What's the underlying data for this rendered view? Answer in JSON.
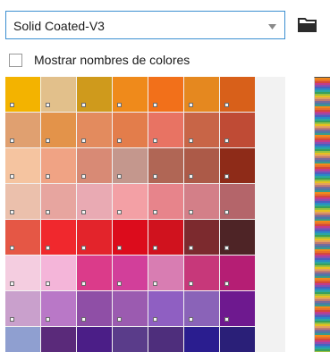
{
  "profile_select": {
    "value": "Solid Coated-V3",
    "icon": "chevron-down-icon"
  },
  "folder_button": {
    "icon": "folder-icon"
  },
  "show_names": {
    "label": "Mostrar nombres de colores",
    "checked": false
  },
  "swatch_rows": [
    [
      "#f3b300",
      "#e2c08b",
      "#cf9a1c",
      "#ef8a1b",
      "#f2701a",
      "#e5881f",
      "#d8601a"
    ],
    [
      "#e0a070",
      "#e3934a",
      "#e38b5e",
      "#e37d4b",
      "#e87363",
      "#c86547",
      "#bf4b35"
    ],
    [
      "#f5c4a0",
      "#f0a384",
      "#d88a75",
      "#c4978d",
      "#b06655",
      "#ac5a48",
      "#8e2b18"
    ],
    [
      "#ebc0ac",
      "#e7a59f",
      "#e9aab3",
      "#f3a0a5",
      "#e7848b",
      "#d37f88",
      "#b4656a"
    ],
    [
      "#e55745",
      "#f0282d",
      "#e3242b",
      "#dc0c1c",
      "#d0121e",
      "#7c2a2e",
      "#4e2426"
    ],
    [
      "#f4cde0",
      "#f4b5d9",
      "#db3b8a",
      "#d23f9a",
      "#d87db2",
      "#c7387a",
      "#b51e74"
    ],
    [
      "#c9a0cc",
      "#b978c7",
      "#8f4fa6",
      "#9b5bb0",
      "#8f5fc2",
      "#8a63b8",
      "#6e198f"
    ],
    [
      "#8f9fd0",
      "#5a2a7a",
      "#4b1e87",
      "#5a3c8a",
      "#4e2e7c",
      "#2a1d8f",
      "#2a1f78"
    ]
  ],
  "strip_colors": [
    "#f08a1a",
    "#e8702a",
    "#d6483a",
    "#c43c8a",
    "#8a4fb0",
    "#4a5fc0",
    "#2a8ac6",
    "#2ba7a0",
    "#3aa05a",
    "#9ac040",
    "#e8c020",
    "#e2a060",
    "#c07a70",
    "#7a6a9a",
    "#4a7aa8",
    "#3a9a8a"
  ]
}
